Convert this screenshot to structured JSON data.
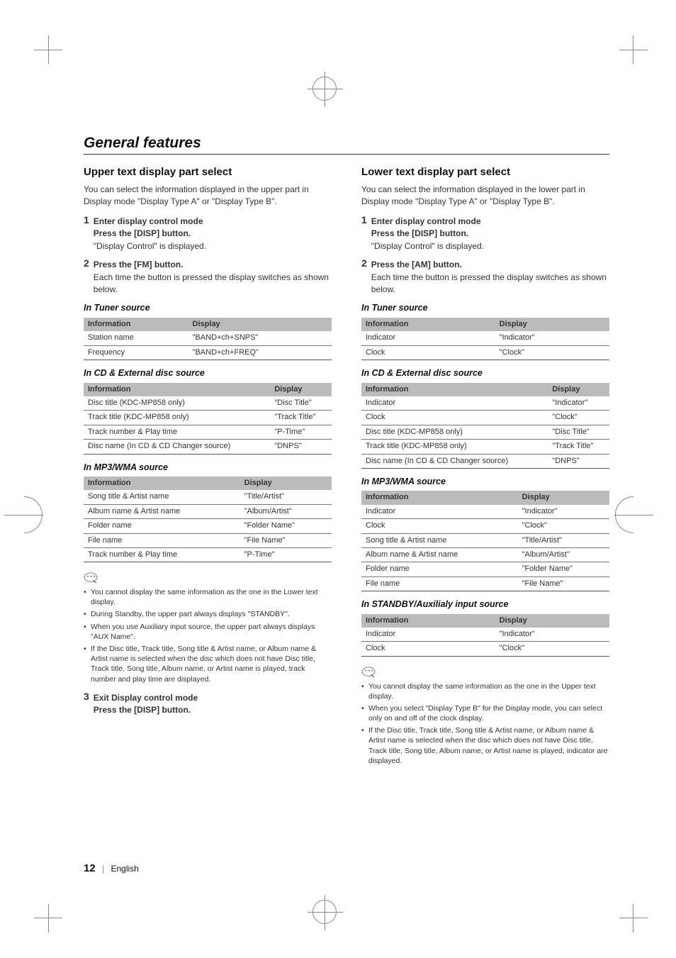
{
  "sectionTitle": "General features",
  "left": {
    "heading": "Upper text display part select",
    "intro": "You can select the information displayed in the upper part in Display mode \"Display Type A\" or \"Display Type B\".",
    "step1_num": "1",
    "step1_line1": "Enter display control mode",
    "step1_line2": "Press the [DISP] button.",
    "step1_line3": "\"Display Control\" is displayed.",
    "step2_num": "2",
    "step2_line1": "Press the [FM] button.",
    "step2_line2": "Each time the button is pressed the display switches as shown below.",
    "tables": {
      "tuner": {
        "title": "In Tuner source",
        "cols": [
          "Information",
          "Display"
        ],
        "rows": [
          [
            "Station name",
            "\"BAND+ch+SNPS\""
          ],
          [
            "Frequency",
            "\"BAND+ch+FREQ\""
          ]
        ]
      },
      "cd": {
        "title": "In CD & External disc source",
        "cols": [
          "Information",
          "Display"
        ],
        "rows": [
          [
            "Disc title (KDC-MP858 only)",
            "\"Disc Title\""
          ],
          [
            "Track title (KDC-MP858 only)",
            "\"Track Title\""
          ],
          [
            "Track number & Play time",
            "\"P-Time\""
          ],
          [
            "Disc name (In CD & CD Changer source)",
            "\"DNPS\""
          ]
        ]
      },
      "mp3": {
        "title": "In MP3/WMA source",
        "cols": [
          "Information",
          "Display"
        ],
        "rows": [
          [
            "Song title & Artist name",
            "\"Title/Artist\""
          ],
          [
            "Album name & Artist name",
            "\"Album/Artist\""
          ],
          [
            "Folder name",
            "\"Folder Name\""
          ],
          [
            "File name",
            "\"File Name\""
          ],
          [
            "Track number & Play time",
            "\"P-Time\""
          ]
        ]
      }
    },
    "notes": [
      "You cannot display the same information as the one in the Lower text display.",
      "During Standby, the upper part always displays \"STANDBY\".",
      "When you use Auxiliary input source, the upper part always displays \"AUX Name\".",
      "If the Disc title, Track title, Song title & Artist name, or Album name & Artist name is selected when the disc which does not have Disc title, Track title, Song title, Album name, or Artist name is played, track number and play time are displayed."
    ],
    "step3_num": "3",
    "step3_line1": "Exit Display control mode",
    "step3_line2": "Press the [DISP] button."
  },
  "right": {
    "heading": "Lower text display part select",
    "intro": "You can select the information displayed in the lower part in Display mode \"Display Type A\" or \"Display Type B\".",
    "step1_num": "1",
    "step1_line1": "Enter display control mode",
    "step1_line2": "Press the [DISP] button.",
    "step1_line3": "\"Display Control\" is displayed.",
    "step2_num": "2",
    "step2_line1": "Press the [AM] button.",
    "step2_line2": "Each time the button is pressed the display switches as shown below.",
    "tables": {
      "tuner": {
        "title": "In Tuner source",
        "cols": [
          "Information",
          "Display"
        ],
        "rows": [
          [
            "Indicator",
            "\"Indicator\""
          ],
          [
            "Clock",
            "\"Clock\""
          ]
        ]
      },
      "cd": {
        "title": "In CD & External disc source",
        "cols": [
          "Information",
          "Display"
        ],
        "rows": [
          [
            "Indicator",
            "\"Indicator\""
          ],
          [
            "Clock",
            "\"Clock\""
          ],
          [
            "Disc title (KDC-MP858 only)",
            "\"Disc Title\""
          ],
          [
            "Track title (KDC-MP858 only)",
            "\"Track Title\""
          ],
          [
            "Disc name (In CD & CD Changer source)",
            "\"DNPS\""
          ]
        ]
      },
      "mp3": {
        "title": "In MP3/WMA source",
        "cols": [
          "Information",
          "Display"
        ],
        "rows": [
          [
            "Indicator",
            "\"Indicator\""
          ],
          [
            "Clock",
            "\"Clock\""
          ],
          [
            "Song title & Artist name",
            "\"Title/Artist\""
          ],
          [
            "Album name & Artist name",
            "\"Album/Artist\""
          ],
          [
            "Folder name",
            "\"Folder Name\""
          ],
          [
            "File name",
            "\"File Name\""
          ]
        ]
      },
      "standby": {
        "title": "In STANDBY/Auxilialy input source",
        "cols": [
          "Information",
          "Display"
        ],
        "rows": [
          [
            "Indicator",
            "\"Indicator\""
          ],
          [
            "Clock",
            "\"Clock\""
          ]
        ]
      }
    },
    "notes": [
      "You cannot display the same information as the one in the Upper text display.",
      "When you select \"Display Type B\" for the Display mode, you can select only on and off of the clock display.",
      "If the Disc title, Track title, Song title & Artist name, or Album name & Artist name is selected when the disc which does not have Disc title, Track title, Song title, Album name, or Artist name is played, indicator are displayed."
    ]
  },
  "footer": {
    "page": "12",
    "lang": "English"
  }
}
